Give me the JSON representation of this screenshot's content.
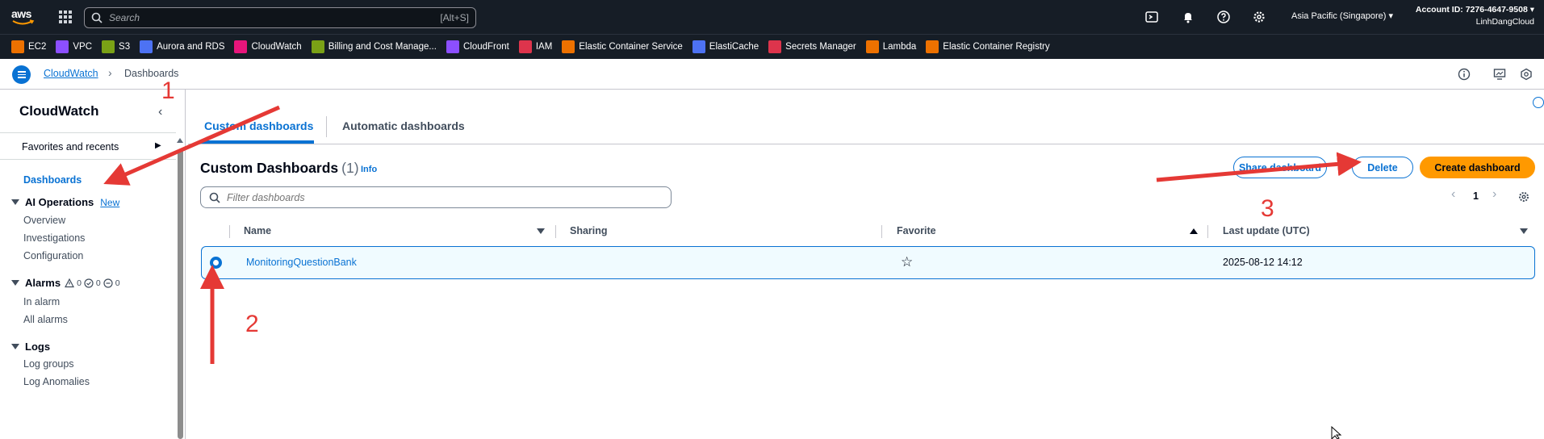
{
  "topbar": {
    "brand": "aws",
    "search_placeholder": "Search",
    "search_shortcut": "[Alt+S]",
    "region": "Asia Pacific (Singapore)",
    "account_id": "Account ID: 7276-4647-9508",
    "account_name": "LinhDangCloud"
  },
  "favorites": [
    {
      "label": "EC2",
      "color": "#ed7100"
    },
    {
      "label": "VPC",
      "color": "#8c4fff"
    },
    {
      "label": "S3",
      "color": "#7aa116"
    },
    {
      "label": "Aurora and RDS",
      "color": "#4d72f3"
    },
    {
      "label": "CloudWatch",
      "color": "#e7157b"
    },
    {
      "label": "Billing and Cost Manage...",
      "color": "#7aa116"
    },
    {
      "label": "CloudFront",
      "color": "#8c4fff"
    },
    {
      "label": "IAM",
      "color": "#dd344c"
    },
    {
      "label": "Elastic Container Service",
      "color": "#ed7100"
    },
    {
      "label": "ElastiCache",
      "color": "#4d72f3"
    },
    {
      "label": "Secrets Manager",
      "color": "#dd344c"
    },
    {
      "label": "Lambda",
      "color": "#ed7100"
    },
    {
      "label": "Elastic Container Registry",
      "color": "#ed7100"
    }
  ],
  "breadcrumb": {
    "parent": "CloudWatch",
    "current": "Dashboards"
  },
  "sidebar": {
    "title": "CloudWatch",
    "favorites_label": "Favorites and recents",
    "active_item": "Dashboards",
    "ai_operations": {
      "label": "AI Operations",
      "badge": "New",
      "items": [
        "Overview",
        "Investigations",
        "Configuration"
      ]
    },
    "alarms": {
      "label": "Alarms",
      "counts": [
        "0",
        "0",
        "0"
      ],
      "items": [
        "In alarm",
        "All alarms"
      ]
    },
    "logs": {
      "label": "Logs",
      "items": [
        "Log groups",
        "Log Anomalies"
      ]
    }
  },
  "tabs": [
    "Custom dashboards",
    "Automatic dashboards"
  ],
  "panel": {
    "title": "Custom Dashboards",
    "count": "(1)",
    "info": "Info",
    "share_button": "Share dashboard",
    "delete_button": "Delete",
    "create_button": "Create dashboard",
    "filter_placeholder": "Filter dashboards",
    "page": "1"
  },
  "table": {
    "columns": [
      "Name",
      "Sharing",
      "Favorite",
      "Last update (UTC)"
    ],
    "rows": [
      {
        "name": "MonitoringQuestionBank",
        "sharing": "",
        "last_update": "2025-08-12 14:12"
      }
    ]
  },
  "annotations": [
    "1",
    "2",
    "3"
  ],
  "colors": {
    "nav_bg": "#161d26",
    "link": "#0972d3",
    "primary": "#ff9900",
    "arrow": "#e53935",
    "row_selected": "#f0fbff"
  }
}
